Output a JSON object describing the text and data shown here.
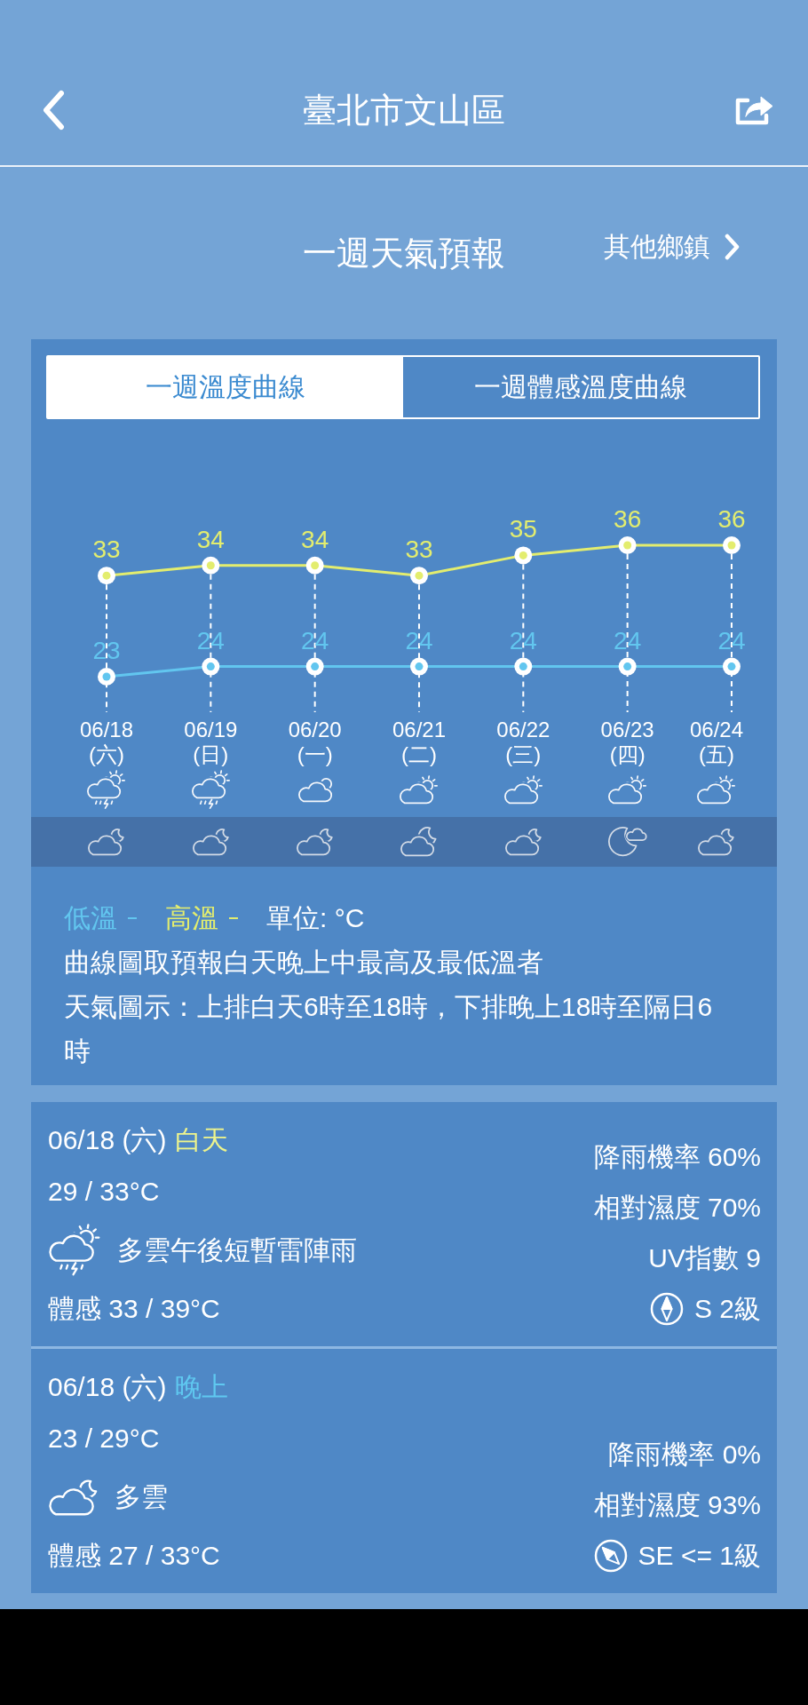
{
  "header": {
    "title": "臺北市文山區"
  },
  "section": {
    "title": "一週天氣預報",
    "link": "其他鄉鎮"
  },
  "tabs": [
    {
      "label": "一週溫度曲線",
      "selected": true
    },
    {
      "label": "一週體感溫度曲線",
      "selected": false
    }
  ],
  "forecast": {
    "chart_data": {
      "type": "line",
      "categories": [
        "06/18",
        "06/19",
        "06/20",
        "06/21",
        "06/22",
        "06/23",
        "06/24"
      ],
      "series": [
        {
          "name": "低溫",
          "color": "#62c6ef",
          "marker": "circle",
          "values": [
            23,
            24,
            24,
            24,
            24,
            24,
            24
          ]
        },
        {
          "name": "高溫",
          "color": "#e3ed6e",
          "marker": "circle",
          "values": [
            33,
            34,
            34,
            33,
            35,
            36,
            36
          ]
        }
      ],
      "grid": true,
      "data_labels": true
    },
    "days": [
      {
        "weekday": "(六)",
        "day_weather": {
          "kind": "thunder"
        },
        "night_weather": {
          "kind": "moon-cloud"
        }
      },
      {
        "weekday": "(日)",
        "day_weather": {
          "kind": "thunder"
        },
        "night_weather": {
          "kind": "moon-cloud"
        }
      },
      {
        "weekday": "(一)",
        "day_weather": {
          "kind": "cloudy"
        },
        "night_weather": {
          "kind": "moon-cloud"
        }
      },
      {
        "weekday": "(二)",
        "day_weather": {
          "kind": "sun-cloud"
        },
        "night_weather": {
          "kind": "large-moon-cloud"
        }
      },
      {
        "weekday": "(三)",
        "day_weather": {
          "kind": "sun-cloud"
        },
        "night_weather": {
          "kind": "moon-cloud"
        }
      },
      {
        "weekday": "(四)",
        "day_weather": {
          "kind": "sun-cloud"
        },
        "night_weather": {
          "kind": "moon"
        }
      },
      {
        "weekday": "(五)",
        "day_weather": {
          "kind": "sun-cloud"
        },
        "night_weather": {
          "kind": "moon-cloud"
        }
      }
    ]
  },
  "legend": {
    "unit": "單位: °C",
    "notes": [
      "曲線圖取預報白天晚上中最高及最低溫者",
      "天氣圖示：上排白天6時至18時，下排晚上18時至隔日6時"
    ]
  },
  "details": [
    {
      "kind": "day",
      "date": "06/18 (六)",
      "period": "白天",
      "temperature": "29 / 33°C",
      "weather": {
        "kind": "thunder"
      },
      "description": "多雲午後短暫雷陣雨",
      "feels_like": "體感 33 / 39°C",
      "stats": [
        "降雨機率 60%",
        "相對濕度 70%",
        "UV指數 9"
      ],
      "wind": {
        "kind": "south",
        "text": "S 2級"
      }
    },
    {
      "kind": "night",
      "date": "06/18 (六)",
      "period": "晚上",
      "temperature": "23 / 29°C",
      "weather": {
        "kind": "moon-cloud"
      },
      "description": "多雲",
      "feels_like": "體感 27 / 33°C",
      "stats": [
        "降雨機率 0%",
        "相對濕度 93%"
      ],
      "wind": {
        "kind": "southeast",
        "text": "SE <= 1級"
      }
    }
  ]
}
